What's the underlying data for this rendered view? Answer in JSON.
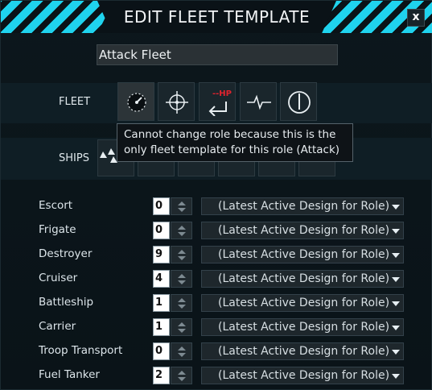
{
  "window": {
    "title": "EDIT FLEET TEMPLATE",
    "close_label": "x",
    "accent_color": "#1fd3ee"
  },
  "template_name": "Attack Fleet",
  "fleet_row": {
    "label": "FLEET",
    "roles": [
      {
        "icon": "radar-dial-icon",
        "selected": true
      },
      {
        "icon": "crosshair-target-icon"
      },
      {
        "icon": "return-low-hp-icon",
        "badge": "--HP"
      },
      {
        "icon": "pulse-line-icon"
      },
      {
        "icon": "power-icon"
      }
    ]
  },
  "ships_row": {
    "label": "SHIPS"
  },
  "tooltip": {
    "line1": "Cannot change role because this is the",
    "line2": "only fleet template for this role (Attack)"
  },
  "ship_classes": [
    {
      "name": "Escort",
      "count": "0",
      "design": "(Latest Active Design for Role)"
    },
    {
      "name": "Frigate",
      "count": "0",
      "design": "(Latest Active Design for Role)"
    },
    {
      "name": "Destroyer",
      "count": "9",
      "design": "(Latest Active Design for Role)"
    },
    {
      "name": "Cruiser",
      "count": "4",
      "design": "(Latest Active Design for Role)"
    },
    {
      "name": "Battleship",
      "count": "1",
      "design": "(Latest Active Design for Role)"
    },
    {
      "name": "Carrier",
      "count": "1",
      "design": "(Latest Active Design for Role)"
    },
    {
      "name": "Troop Transport",
      "count": "0",
      "design": "(Latest Active Design for Role)"
    },
    {
      "name": "Fuel Tanker",
      "count": "2",
      "design": "(Latest Active Design for Role)"
    }
  ]
}
